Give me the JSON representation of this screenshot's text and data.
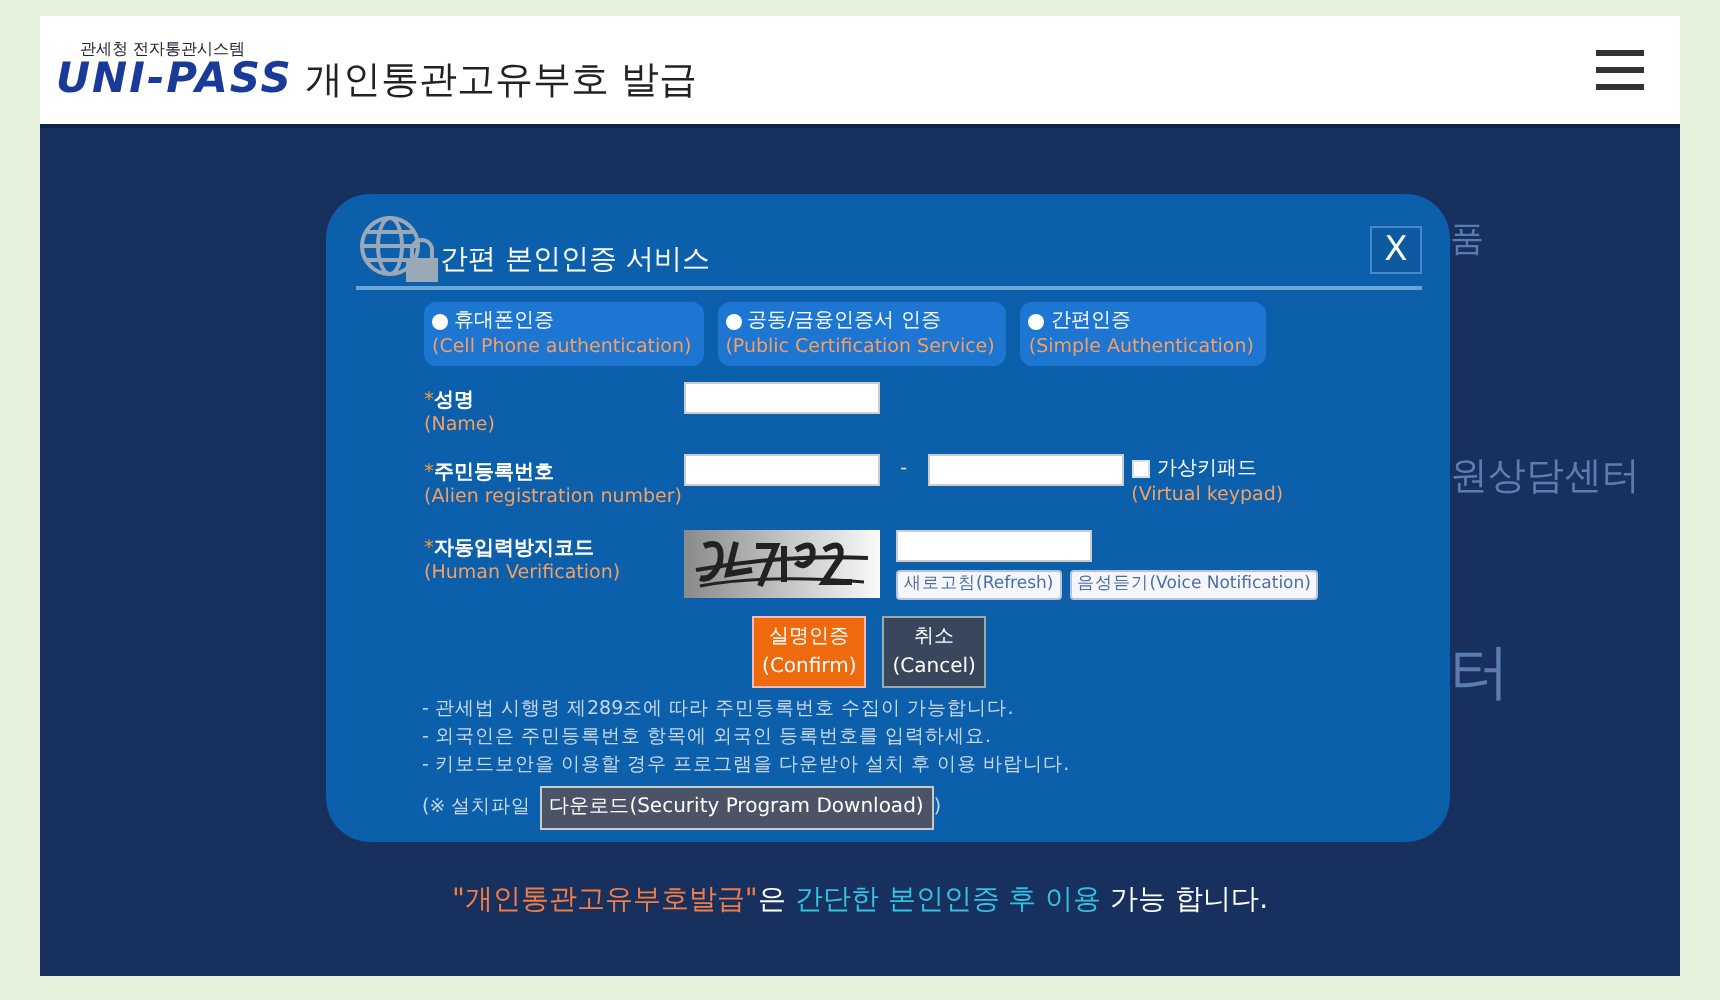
{
  "header": {
    "logo_caption": "관세청 전자통관시스템",
    "logo": "UNI-PASS",
    "title": "개인통관고유부호 발급"
  },
  "background_fragments": [
    "품",
    "원상담센터",
    "터"
  ],
  "dialog": {
    "title": "간편 본인인증 서비스",
    "close": "X",
    "methods": [
      {
        "label": "휴대폰인증",
        "english": "(Cell Phone authentication)",
        "selected": false
      },
      {
        "label": "공동/금융인증서 인증",
        "english": "(Public Certification Service)",
        "selected": false
      },
      {
        "label": "간편인증",
        "english": "(Simple Authentication)",
        "selected": false
      }
    ],
    "fields": [
      {
        "kind": "name",
        "required_mark": "*",
        "label": "성명",
        "english": "(Name)"
      },
      {
        "kind": "registration",
        "required_mark": "*",
        "label": "주민등록번호",
        "english": "(Alien registration number)",
        "separator": "-",
        "keypad": {
          "label": "가상키패드",
          "english": "(Virtual keypad)",
          "checked": false
        }
      },
      {
        "kind": "captcha",
        "required_mark": "*",
        "label": "자동입력방지코드",
        "english": "(Human Verification)",
        "captcha": {
          "kind": "picture"
        },
        "buttons": [
          "새로고침(Refresh)",
          "음성듣기(Voice Notification)"
        ]
      }
    ],
    "confirm": {
      "label": "실명인증",
      "english": "(Confirm)"
    },
    "cancel": {
      "label": "취소",
      "english": "(Cancel)"
    },
    "notes": [
      "- 관세법 시행령 제289조에 따라 주민등록번호 수집이 가능합니다.",
      "- 외국인은 주민등록번호 항목에 외국인 등록번호를 입력하세요.",
      "- 키보드보안을 이용할 경우 프로그램을 다운받아 설치 후 이용 바랍니다."
    ],
    "download": {
      "prefix": "(※ 설치파일",
      "button": "다운로드(Security Program Download)",
      "suffix": ")"
    }
  },
  "footer_note": [
    {
      "kind": "accent",
      "text": "\"개인통관고유부호발급\""
    },
    {
      "kind": "plain",
      "text": "은 "
    },
    {
      "kind": "highlight",
      "text": "간단한 본인인증 후 이용"
    },
    {
      "kind": "plain",
      "text": " 가능 합니다."
    }
  ]
}
